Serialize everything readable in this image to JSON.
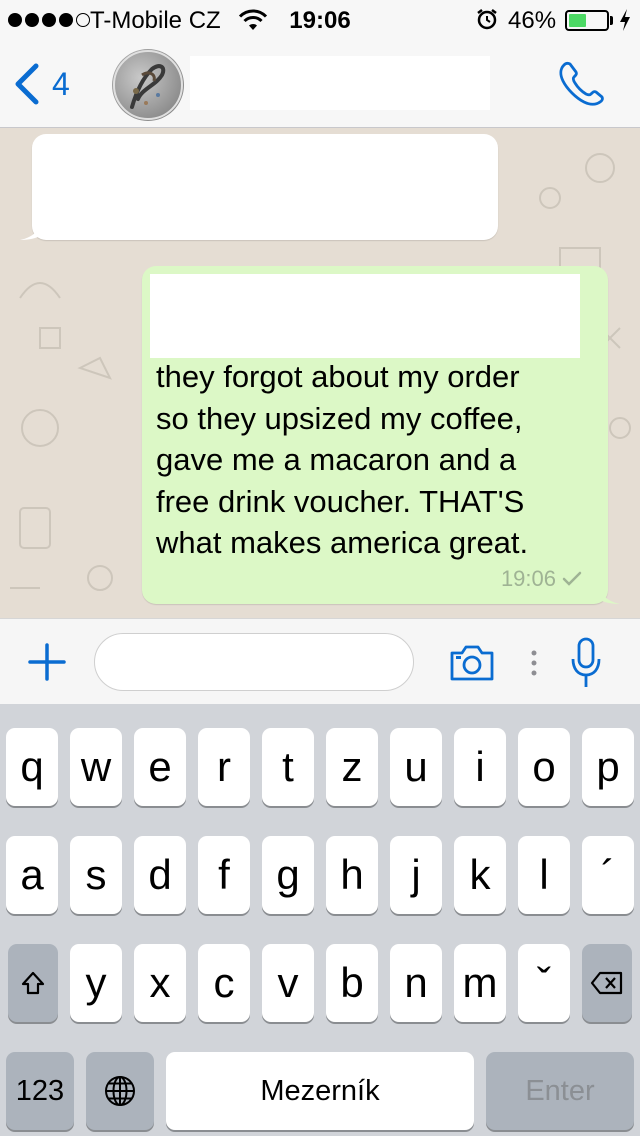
{
  "status_bar": {
    "signal_bars_filled": 4,
    "signal_bars_total": 5,
    "carrier": "T-Mobile CZ",
    "time": "19:06",
    "battery_percent": "46%",
    "battery_level": 0.46,
    "icons": [
      "wifi-icon",
      "alarm-icon",
      "battery-icon",
      "charging-bolt-icon"
    ]
  },
  "nav_bar": {
    "back_count": "4",
    "contact_name": "",
    "icons": [
      "chevron-left-icon",
      "phone-icon"
    ]
  },
  "messages": [
    {
      "direction": "incoming",
      "text": ""
    },
    {
      "direction": "outgoing",
      "redacted_prefix": "",
      "text": "they forgot about my order\nso they upsized my coffee,\ngave me a macaron and a\nfree drink voucher. THAT'S\nwhat makes america great.",
      "time": "19:06",
      "status": "sent",
      "status_icon": "checkmark-icon"
    }
  ],
  "input_bar": {
    "value": "",
    "placeholder": "",
    "icons": [
      "plus-icon",
      "camera-icon",
      "more-icon",
      "microphone-icon"
    ]
  },
  "keyboard": {
    "rows": [
      [
        "q",
        "w",
        "e",
        "r",
        "t",
        "z",
        "u",
        "i",
        "o",
        "p"
      ],
      [
        "a",
        "s",
        "d",
        "f",
        "g",
        "h",
        "j",
        "k",
        "l",
        "´"
      ],
      [
        "y",
        "x",
        "c",
        "v",
        "b",
        "n",
        "m",
        "ˇ"
      ]
    ],
    "numbers_key": "123",
    "space_key": "Mezerník",
    "enter_key": "Enter",
    "icons": [
      "shift-icon",
      "backspace-icon",
      "globe-icon"
    ]
  },
  "colors": {
    "accent": "#0a6cd1",
    "outgoing_bubble": "#dcf8c6",
    "incoming_bubble": "#ffffff",
    "chat_background": "#e5ddd3",
    "battery_fill": "#4cd964"
  }
}
